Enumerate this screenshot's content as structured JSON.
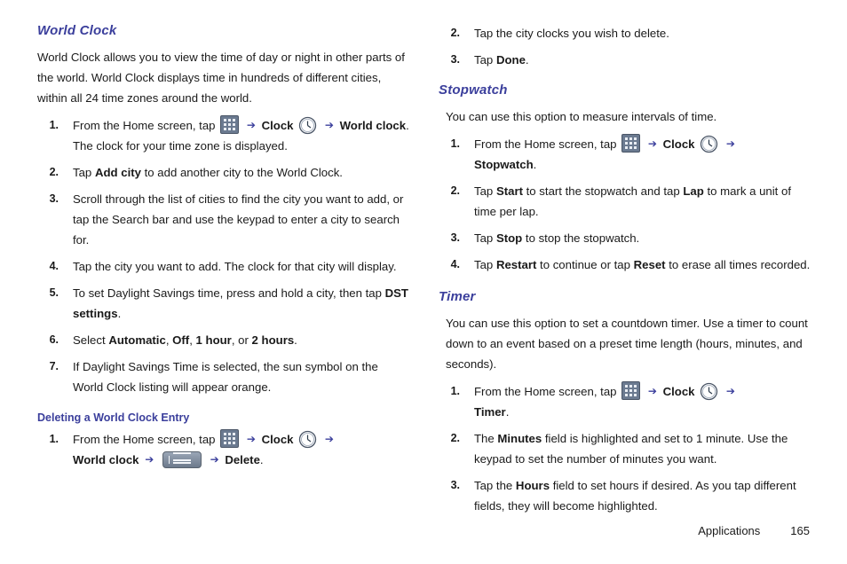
{
  "document": {
    "footer": {
      "section_label": "Applications",
      "page_number": "165"
    }
  },
  "icons": {
    "apps": "apps-grid-icon",
    "clock": "clock-icon",
    "menu": "menu-key-icon",
    "arrow": "➔"
  },
  "left_column": {
    "section_title": "World Clock",
    "intro": "World Clock allows you to view the time of day or night in other parts of the world. World Clock displays time in hundreds of different cities, within all 24 time zones around the world.",
    "steps": [
      {
        "num": "1.",
        "pre": "From the Home screen, tap",
        "mid": "Clock",
        "post_bold": "World clock",
        "post": ". The clock for your time zone is displayed."
      },
      {
        "num": "2.",
        "text_pre": "Tap ",
        "bold": "Add city",
        "text_post": " to add another city to the World Clock."
      },
      {
        "num": "3.",
        "text": "Scroll through the list of cities to find the city you want to add, or tap the Search bar and use the keypad to enter a city to search for."
      },
      {
        "num": "4.",
        "text": "Tap the city you want to add. The clock for that city will display."
      },
      {
        "num": "5.",
        "text_pre": "To set Daylight Savings time, press and hold a city, then tap ",
        "bold": "DST settings",
        "text_post": "."
      },
      {
        "num": "6.",
        "text_pre": "Select ",
        "bold1": "Automatic",
        "sep1": ", ",
        "bold2": "Off",
        "sep2": ", ",
        "bold3": "1 hour",
        "sep3": ", or ",
        "bold4": "2 hours",
        "text_post": "."
      },
      {
        "num": "7.",
        "text": "If Daylight Savings Time is selected, the sun symbol on the World Clock listing will appear orange."
      }
    ],
    "subsection_title": "Deleting a World Clock Entry",
    "sub_steps": [
      {
        "num": "1.",
        "pre": "From the Home screen, tap",
        "mid": "Clock",
        "post_bold": "World clock",
        "post_bold2": "Delete",
        "post": "."
      }
    ]
  },
  "right_column": {
    "continued_steps": [
      {
        "num": "2.",
        "text": "Tap the city clocks you wish to delete."
      },
      {
        "num": "3.",
        "text_pre": "Tap ",
        "bold": "Done",
        "text_post": "."
      }
    ],
    "stopwatch": {
      "title": "Stopwatch",
      "intro": "You can use this option to measure intervals of time.",
      "steps": [
        {
          "num": "1.",
          "pre": "From the Home screen, tap",
          "mid": "Clock",
          "post_bold": "Stopwatch",
          "post": "."
        },
        {
          "num": "2.",
          "text_pre": "Tap ",
          "bold1": "Start",
          "mid_text": " to start the stopwatch and tap ",
          "bold2": "Lap",
          "text_post": " to mark a unit of time per lap."
        },
        {
          "num": "3.",
          "text_pre": "Tap ",
          "bold": "Stop",
          "text_post": " to stop the stopwatch."
        },
        {
          "num": "4.",
          "text_pre": "Tap ",
          "bold1": "Restart",
          "mid_text": " to continue or tap ",
          "bold2": "Reset",
          "text_post": " to erase all times recorded."
        }
      ]
    },
    "timer": {
      "title": "Timer",
      "intro": "You can use this option to set a countdown timer. Use a timer to count down to an event based on a preset time length (hours, minutes, and seconds).",
      "steps": [
        {
          "num": "1.",
          "pre": "From the Home screen, tap",
          "mid": "Clock",
          "post_bold": "Timer",
          "post": "."
        },
        {
          "num": "2.",
          "text_pre": "The ",
          "bold": "Minutes",
          "text_post": " field is highlighted and set to 1 minute. Use the keypad to set the number of minutes you want."
        },
        {
          "num": "3.",
          "text_pre": "Tap the ",
          "bold": "Hours",
          "text_post": " field to set hours if desired. As you tap different fields, they will become highlighted."
        }
      ]
    }
  }
}
